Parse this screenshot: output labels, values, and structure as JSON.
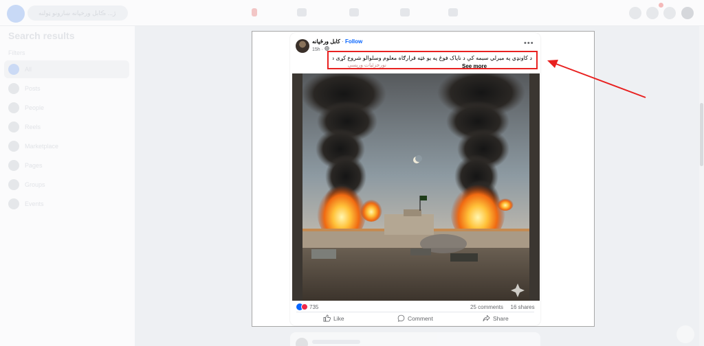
{
  "topbar": {
    "search_placeholder": "ژ... ڪابل ورخپانه ښارونو ټولنه",
    "icons": [
      "facebook-logo",
      "home-icon",
      "video-icon",
      "marketplace-icon",
      "groups-icon",
      "menu-icon",
      "messenger-icon",
      "bell-icon",
      "avatar"
    ]
  },
  "sidebar": {
    "title": "Search results",
    "filters_label": "Filters",
    "items": [
      {
        "label": "All",
        "icon": "all-icon"
      },
      {
        "label": "Posts",
        "icon": "posts-icon"
      },
      {
        "label": "People",
        "icon": "people-icon"
      },
      {
        "label": "Reels",
        "icon": "reels-icon"
      },
      {
        "label": "Marketplace",
        "icon": "marketplace-icon"
      },
      {
        "label": "Pages",
        "icon": "pages-icon"
      },
      {
        "label": "Groups",
        "icon": "groups-icon"
      },
      {
        "label": "Events",
        "icon": "events-icon"
      }
    ]
  },
  "post": {
    "author": "کابل ورځپانه",
    "follow": "Follow",
    "separator": "·",
    "time": "15h",
    "privacy_icon": "globe-icon",
    "more": "•••",
    "text": "د کاونډي په میرلي سیمه کې د ناپاک فوځ په یو غټه قرارګاه معلوم وسلوالو شروع کړی ده🔥",
    "tags": "نورجزئیات ورپسې",
    "see_more": "See more",
    "reaction_count": "735",
    "comments": "25 comments",
    "shares": "16 shares",
    "actions": {
      "like": "Like",
      "comment": "Comment",
      "share": "Share"
    }
  },
  "colors": {
    "accent": "#0866ff",
    "annotation_red": "#e8201f",
    "love": "#f02849"
  }
}
